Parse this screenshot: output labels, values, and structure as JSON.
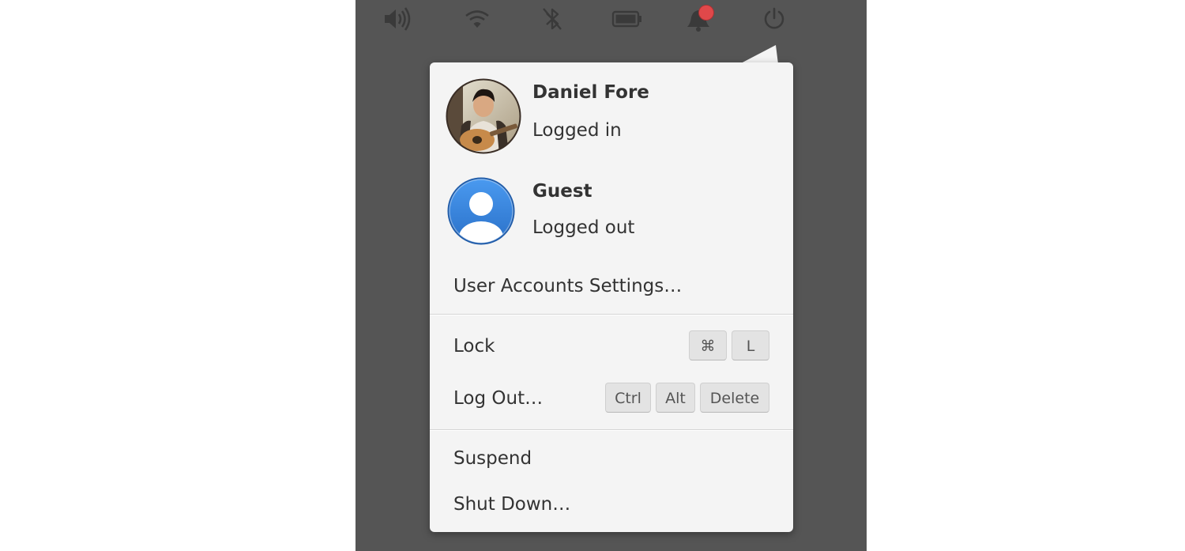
{
  "panel": {
    "icons": [
      "volume-icon",
      "wifi-icon",
      "bluetooth-disabled-icon",
      "battery-icon",
      "notification-bell-icon",
      "power-icon"
    ],
    "notification_badge_color": "#e0484a"
  },
  "users": [
    {
      "name": "Daniel Fore",
      "status": "Logged in",
      "avatar": "user-photo"
    },
    {
      "name": "Guest",
      "status": "Logged out",
      "avatar": "guest-avatar-icon"
    }
  ],
  "menu": {
    "user_accounts": "User Accounts Settings…",
    "lock": {
      "label": "Lock",
      "keys": [
        "⌘",
        "L"
      ]
    },
    "logout": {
      "label": "Log Out…",
      "keys": [
        "Ctrl",
        "Alt",
        "Delete"
      ]
    },
    "suspend": "Suspend",
    "shutdown": "Shut Down…"
  },
  "colors": {
    "panel_background": "#555555",
    "popover_background": "#f4f4f4",
    "guest_avatar": "#3a88de",
    "text": "#333333"
  }
}
